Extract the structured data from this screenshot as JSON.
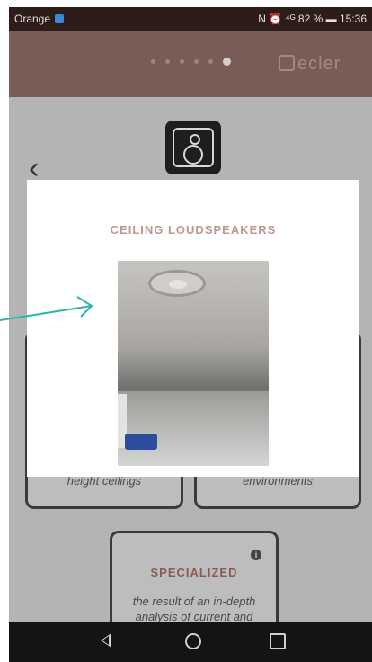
{
  "status_bar": {
    "carrier": "Orange",
    "indicators": "N ⏰ ⁴ᴳ",
    "battery": "82 %",
    "time": "15:36"
  },
  "header": {
    "logo_text": "ecler",
    "page_dots": 6,
    "active_dot_index": 5
  },
  "speaker_icon": "speaker-icon",
  "modal": {
    "title": "CEILING LOUDSPEAKERS",
    "image": "ceiling-speaker-photo"
  },
  "cards": {
    "left_text": "height ceilings",
    "right_text": "environments",
    "specialized": {
      "title": "SPECIALIZED",
      "text_line1": "the result of an in-depth",
      "text_line2": "analysis of current and"
    }
  },
  "colors": {
    "accent": "#c0968d",
    "header": "#7a5c56",
    "annotation": "#2bb5a8"
  }
}
